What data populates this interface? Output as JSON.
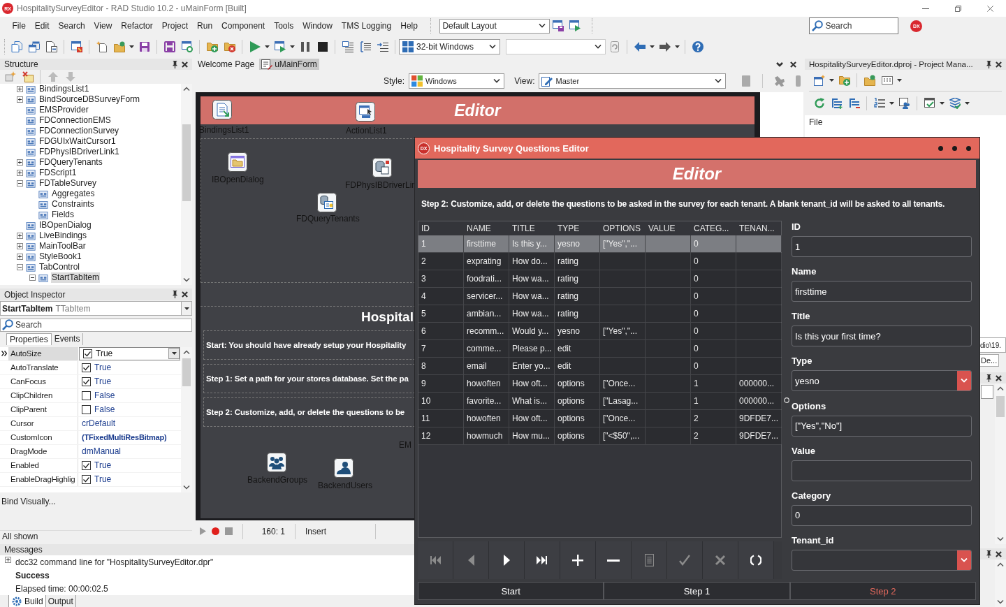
{
  "window": {
    "logo": "RX",
    "title": "HospitalitySurveyEditor - RAD Studio 10.2 - uMainForm [Built]"
  },
  "menu": [
    "File",
    "Edit",
    "Search",
    "View",
    "Refactor",
    "Project",
    "Run",
    "Component",
    "Tools",
    "Window",
    "TMS Logging",
    "Help"
  ],
  "toolbar": {
    "layout": "Default Layout",
    "platform": "32-bit Windows",
    "search": {
      "placeholder": "Search"
    },
    "badge": "DX"
  },
  "structure": {
    "title": "Structure",
    "tree": [
      {
        "label": "BindingsList1",
        "expanded": false,
        "selected": false
      },
      {
        "label": "BindSourceDBSurveyForm",
        "expanded": false,
        "selected": false
      },
      {
        "label": "EMSProvider",
        "selected": false
      },
      {
        "label": "FDConnectionEMS",
        "selected": false
      },
      {
        "label": "FDConnectionSurvey",
        "selected": false
      },
      {
        "label": "FDGUIxWaitCursor1",
        "selected": false
      },
      {
        "label": "FDPhysIBDriverLink1",
        "selected": false
      },
      {
        "label": "FDQueryTenants",
        "expanded": false,
        "selected": false
      },
      {
        "label": "FDScript1",
        "expanded": false,
        "selected": false
      },
      {
        "label": "FDTableSurvey",
        "expanded": true,
        "selected": false,
        "children": [
          {
            "label": "Aggregates",
            "selected": false
          },
          {
            "label": "Constraints",
            "selected": false
          },
          {
            "label": "Fields",
            "selected": false
          }
        ]
      },
      {
        "label": "IBOpenDialog",
        "selected": false
      },
      {
        "label": "LiveBindings",
        "expanded": false,
        "selected": false
      },
      {
        "label": "MainToolBar",
        "expanded": false,
        "selected": false
      },
      {
        "label": "StyleBook1",
        "expanded": false,
        "selected": false
      },
      {
        "label": "TabControl",
        "expanded": true,
        "selected": false,
        "children": [
          {
            "label": "StartTabItem",
            "expanded": true,
            "selected": true
          }
        ]
      }
    ]
  },
  "object_inspector": {
    "title": "Object Inspector",
    "component": "StartTabItem",
    "component_type": "TTabItem",
    "search": {
      "placeholder": "Search"
    },
    "tabs": [
      {
        "label": "Properties",
        "selected": true
      },
      {
        "label": "Events",
        "selected": false
      }
    ],
    "properties": [
      {
        "name": "AutoSize",
        "kind": "bool",
        "checked": true,
        "value": "True",
        "selected": true
      },
      {
        "name": "AutoTranslate",
        "kind": "bool",
        "checked": true,
        "value": "True",
        "selected": false
      },
      {
        "name": "CanFocus",
        "kind": "bool",
        "checked": true,
        "value": "True",
        "selected": false
      },
      {
        "name": "ClipChildren",
        "kind": "bool",
        "checked": false,
        "value": "False",
        "selected": false
      },
      {
        "name": "ClipParent",
        "kind": "bool",
        "checked": false,
        "value": "False",
        "selected": false
      },
      {
        "name": "Cursor",
        "kind": "text",
        "value": "crDefault",
        "selected": false
      },
      {
        "name": "CustomIcon",
        "kind": "object",
        "value": "(TFixedMultiResBitmap)",
        "selected": false
      },
      {
        "name": "DragMode",
        "kind": "text",
        "value": "dmManual",
        "selected": false
      },
      {
        "name": "Enabled",
        "kind": "bool",
        "checked": true,
        "value": "True",
        "selected": false
      },
      {
        "name": "EnableDragHighlig",
        "kind": "bool",
        "checked": true,
        "value": "True",
        "selected": false
      }
    ],
    "bind_link": "Bind Visually...",
    "status": "All shown"
  },
  "editor_tabs": [
    {
      "label": "Welcome Page",
      "kind": "page",
      "selected": false
    },
    {
      "label": "uMainForm",
      "kind": "form",
      "selected": true
    }
  ],
  "designer": {
    "style_label": "Style:",
    "style": "Windows",
    "view_label": "View:",
    "view": "Master",
    "form": {
      "header": "Editor",
      "components": [
        {
          "label": "BindingsList1",
          "kind": "bindings"
        },
        {
          "label": "ActionList1",
          "kind": "actions"
        },
        {
          "label": "IBOpenDialog",
          "kind": "dialog"
        },
        {
          "label": "FDPhysIBDriverLin",
          "kind": "driver"
        },
        {
          "label": "FDQueryTenants",
          "kind": "query"
        },
        {
          "label": "EM",
          "kind": "label_only"
        },
        {
          "label": "BackendGroups",
          "kind": "groups"
        },
        {
          "label": "BackendUsers",
          "kind": "users"
        }
      ],
      "heading": "Hospital",
      "steps": [
        "Start: You should have already setup your Hospitality",
        "Step 1: Set a path for your stores database. Set the pa",
        "Step 2: Customize, add, or delete the questions to be"
      ]
    },
    "status": {
      "position": "160: 1",
      "mode": "Insert"
    }
  },
  "messages": {
    "title": "Messages",
    "lines": [
      {
        "kind": "group",
        "text": "dcc32 command line for \"HospitalitySurveyEditor.dpr\""
      },
      {
        "kind": "bold",
        "text": "Success"
      },
      {
        "kind": "plain",
        "text": "Elapsed time: 00:00:02.5"
      }
    ],
    "tabs": [
      {
        "label": "Build",
        "kind": "build",
        "selected": true
      },
      {
        "label": "Output",
        "kind": "output",
        "selected": false
      }
    ]
  },
  "project_manager": {
    "title": "HospitalitySurveyEditor.dproj - Project Mana...",
    "column": "File",
    "path": "dio\\19.",
    "tab": "De..."
  },
  "dialog": {
    "icon": "DX",
    "title": "Hospitality Survey Questions Editor",
    "header": "Editor",
    "instructions": "Step 2: Customize, add, or delete the questions to be asked in the survey for each tenant. A blank tenant_id will be asked to all tenants.",
    "columns": [
      "ID",
      "NAME",
      "TITLE",
      "TYPE",
      "OPTIONS",
      "VALUE",
      "CATEG...",
      "TENAN..."
    ],
    "rows": [
      {
        "selected": true,
        "id": "1",
        "name": "firsttime",
        "title": "Is this y...",
        "type": "yesno",
        "options": "[\"Yes\",\"...",
        "category": "0"
      },
      {
        "selected": false,
        "id": "2",
        "name": "exprating",
        "title": "How do...",
        "type": "rating",
        "category": "0"
      },
      {
        "selected": false,
        "id": "3",
        "name": "foodrati...",
        "title": "How wa...",
        "type": "rating",
        "category": "0"
      },
      {
        "selected": false,
        "id": "4",
        "name": "servicer...",
        "title": "How wa...",
        "type": "rating",
        "category": "0"
      },
      {
        "selected": false,
        "id": "5",
        "name": "ambian...",
        "title": "How wa...",
        "type": "rating",
        "category": "0"
      },
      {
        "selected": false,
        "id": "6",
        "name": "recomm...",
        "title": "Would y...",
        "type": "yesno",
        "options": "[\"Yes\",\"...",
        "category": "0"
      },
      {
        "selected": false,
        "id": "7",
        "name": "comme...",
        "title": "Please p...",
        "type": "edit",
        "category": "0"
      },
      {
        "selected": false,
        "id": "8",
        "name": "email",
        "title": "Enter yo...",
        "type": "edit",
        "category": "0"
      },
      {
        "selected": false,
        "id": "9",
        "name": "howoften",
        "title": "How oft...",
        "type": "options",
        "options": "[\"Once...",
        "category": "1",
        "tenant": "000000..."
      },
      {
        "selected": false,
        "id": "10",
        "name": "favorite...",
        "title": "What is...",
        "type": "options",
        "options": "[\"Lasag...",
        "category": "1",
        "tenant": "000000..."
      },
      {
        "selected": false,
        "id": "11",
        "name": "howoften",
        "title": "How oft...",
        "type": "options",
        "options": "[\"Once...",
        "category": "2",
        "tenant": "9DFDE7..."
      },
      {
        "selected": false,
        "id": "12",
        "name": "howmuch",
        "title": "How mu...",
        "type": "options",
        "options": "[\"<$50\",...",
        "category": "2",
        "tenant": "9DFDE7..."
      }
    ],
    "fields": [
      {
        "label": "ID",
        "kind": "text",
        "value": "1"
      },
      {
        "label": "Name",
        "kind": "text",
        "value": "firsttime"
      },
      {
        "label": "Title",
        "kind": "text",
        "value": "Is this your first time?"
      },
      {
        "label": "Type",
        "kind": "dropdown",
        "value": "yesno"
      },
      {
        "label": "Options",
        "kind": "text",
        "value": "[\"Yes\",\"No\"]"
      },
      {
        "label": "Value",
        "kind": "text"
      },
      {
        "label": "Category",
        "kind": "text",
        "value": "0"
      },
      {
        "label": "Tenant_id",
        "kind": "dropdown"
      }
    ],
    "navigator": [
      {
        "kind": "first",
        "disabled": true
      },
      {
        "kind": "prior",
        "disabled": true
      },
      {
        "kind": "next",
        "disabled": false
      },
      {
        "kind": "last",
        "disabled": false
      },
      {
        "kind": "insert",
        "disabled": false
      },
      {
        "kind": "delete",
        "disabled": false
      },
      {
        "kind": "edit",
        "disabled": true
      },
      {
        "kind": "post",
        "disabled": true
      },
      {
        "kind": "cancel",
        "disabled": true
      },
      {
        "kind": "refresh",
        "disabled": false
      }
    ],
    "tabs": [
      {
        "label": "Start",
        "selected": false
      },
      {
        "label": "Step 1",
        "selected": false
      },
      {
        "label": "Step 2",
        "selected": true
      }
    ]
  }
}
